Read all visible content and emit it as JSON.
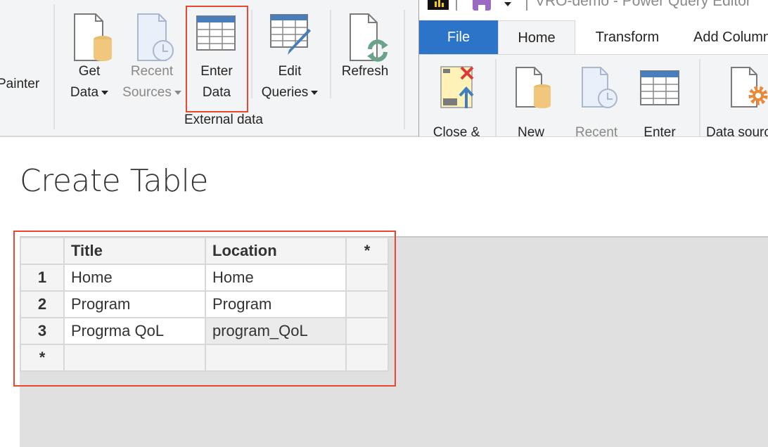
{
  "ribbon": {
    "partial_label": "Painter",
    "buttons": [
      {
        "line1": "Get",
        "line2": "Data",
        "has_dropdown": true,
        "disabled": false,
        "icon": "get-data-icon"
      },
      {
        "line1": "Recent",
        "line2": "Sources",
        "has_dropdown": true,
        "disabled": true,
        "icon": "recent-sources-icon"
      },
      {
        "line1": "Enter",
        "line2": "Data",
        "has_dropdown": false,
        "disabled": false,
        "icon": "enter-data-icon",
        "highlighted": true
      },
      {
        "line1": "Edit",
        "line2": "Queries",
        "has_dropdown": true,
        "disabled": false,
        "icon": "edit-queries-icon"
      },
      {
        "line1": "Refresh",
        "line2": "",
        "has_dropdown": false,
        "disabled": false,
        "icon": "refresh-icon"
      }
    ],
    "group_label": "External data"
  },
  "power_query": {
    "window_title": "VRO-demo - Power Query Editor",
    "tabs": [
      {
        "label": "File",
        "active": false
      },
      {
        "label": "Home",
        "active": true
      },
      {
        "label": "Transform",
        "active": false
      },
      {
        "label": "Add Column",
        "active": false
      }
    ],
    "buttons": [
      {
        "label": "Close &",
        "icon": "close-apply-icon"
      },
      {
        "label": "New",
        "icon": "new-source-icon"
      },
      {
        "label": "Recent",
        "icon": "recent-sources-icon",
        "disabled": true
      },
      {
        "label": "Enter",
        "icon": "enter-data-icon"
      },
      {
        "label": "Data source",
        "icon": "data-source-settings-icon"
      }
    ]
  },
  "dialog": {
    "title": "Create Table",
    "table": {
      "columns": [
        "Title",
        "Location",
        "*"
      ],
      "rows": [
        {
          "num": "1",
          "cells": [
            "Home",
            "Home"
          ]
        },
        {
          "num": "2",
          "cells": [
            "Program",
            "Program"
          ]
        },
        {
          "num": "3",
          "cells": [
            "Progrma QoL",
            "program_QoL"
          ]
        }
      ],
      "new_row_marker": "*"
    }
  },
  "colors": {
    "highlight": "#e8482f",
    "file_tab": "#2b74c7",
    "accent_table": "#4a7ebb"
  }
}
